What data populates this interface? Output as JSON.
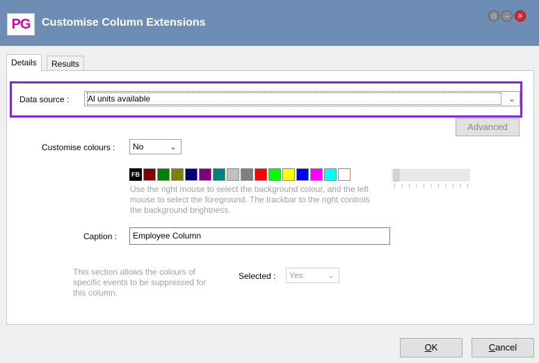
{
  "window": {
    "logo_text": "PG",
    "title": "Customise Column Extensions",
    "controls": [
      "restore-icon",
      "minimize-icon",
      "close-icon"
    ]
  },
  "tabs": [
    {
      "label": "Details",
      "active": true
    },
    {
      "label": "Results",
      "active": false
    }
  ],
  "data_source": {
    "label": "Data source :",
    "value": "Al units available"
  },
  "advanced_button": {
    "label": "Advanced",
    "enabled": false
  },
  "customise_colours": {
    "label": "Customise colours :",
    "value": "No"
  },
  "palette": {
    "fb_label": "FB",
    "colors": [
      "#800000",
      "#008000",
      "#808000",
      "#000080",
      "#800080",
      "#008080",
      "#c0c0c0",
      "#808080",
      "#ff0000",
      "#00ff00",
      "#ffff00",
      "#0000ff",
      "#ff00ff",
      "#00ffff",
      "#ffffff"
    ]
  },
  "palette_hint": "Use the right mouse to select the background colour, and the left mouse to select the foreground. The trackbar to the right controls the background brightness.",
  "caption": {
    "label": "Caption :",
    "value": "Employee Column"
  },
  "suppress_note": "This section allows the colours of specific events to be suppressed for this column.",
  "selected": {
    "label": "Selected :",
    "value": "Yes"
  },
  "footer": {
    "ok_key": "O",
    "ok_rest": "K",
    "cancel_key": "C",
    "cancel_rest": "ancel"
  }
}
